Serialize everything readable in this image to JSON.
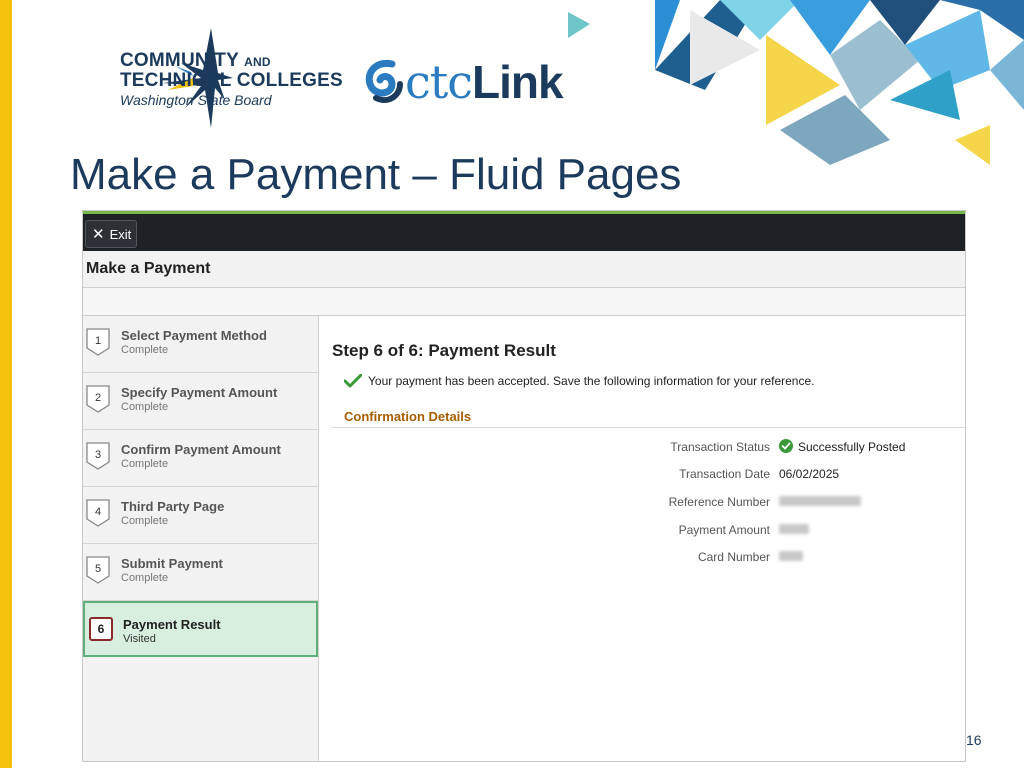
{
  "slide": {
    "title": "Make a Payment – Fluid Pages",
    "page_number": "16",
    "org_line_1": "COMMUNITY",
    "org_line_1_and": "AND",
    "org_line_2": "TECHNICAL COLLEGES",
    "org_line_3": "Washington State Board",
    "brand_ctc": "ctc",
    "brand_link": "Link"
  },
  "app": {
    "exit_label": "Exit",
    "page_title": "Make a Payment",
    "steps": [
      {
        "num": "1",
        "label": "Select Payment Method",
        "status": "Complete"
      },
      {
        "num": "2",
        "label": "Specify Payment Amount",
        "status": "Complete"
      },
      {
        "num": "3",
        "label": "Confirm Payment Amount",
        "status": "Complete"
      },
      {
        "num": "4",
        "label": "Third Party Page",
        "status": "Complete"
      },
      {
        "num": "5",
        "label": "Submit Payment",
        "status": "Complete"
      },
      {
        "num": "6",
        "label": "Payment Result",
        "status": "Visited"
      }
    ],
    "main": {
      "heading": "Step 6 of 6: Payment Result",
      "success_message": "Your payment has been accepted. Save the following information for your reference.",
      "section_title": "Confirmation Details",
      "fields": {
        "status_label": "Transaction Status",
        "status_value": "Successfully Posted",
        "date_label": "Transaction Date",
        "date_value": "06/02/2025",
        "reference_label": "Reference Number",
        "amount_label": "Payment Amount",
        "card_label": "Card Number"
      }
    }
  },
  "colors": {
    "accent_yellow": "#f4c20d",
    "navy": "#1b3a5c",
    "success_green": "#3a9a3a",
    "section_orange": "#a85d00",
    "active_step_bg": "#d8efdf"
  }
}
